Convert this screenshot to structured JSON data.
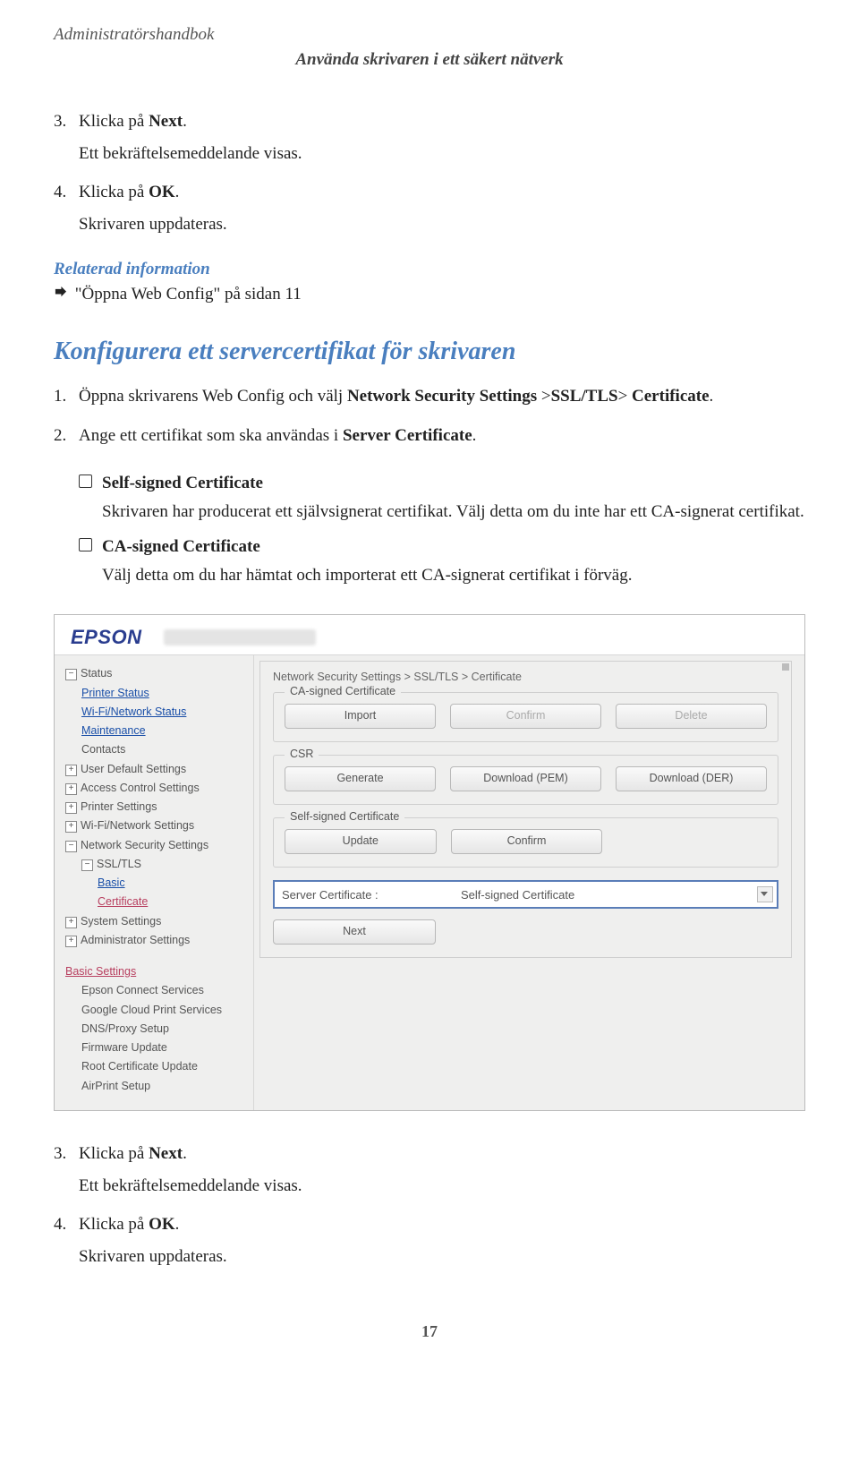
{
  "header": {
    "doc_title": "Administratörshandbok",
    "section_title": "Använda skrivaren i ett säkert nätverk"
  },
  "steps_top": [
    {
      "n": "3.",
      "text": "Klicka på ",
      "bold": "Next",
      "tail": ".",
      "sub": "Ett bekräftelsemeddelande visas."
    },
    {
      "n": "4.",
      "text": "Klicka på ",
      "bold": "OK",
      "tail": ".",
      "sub": "Skrivaren uppdateras."
    }
  ],
  "related": {
    "heading": "Relaterad information",
    "link": "\"Öppna Web Config\" på sidan 11"
  },
  "h2": "Konfigurera ett servercertifikat för skrivaren",
  "steps_mid": [
    {
      "n": "1.",
      "text": "Öppna skrivarens Web Config och välj ",
      "bold": "Network Security Settings",
      "tail1": " >",
      "bold2": "SSL/TLS",
      "tail2": "> ",
      "bold3": "Certificate",
      "tail3": "."
    },
    {
      "n": "2.",
      "text": "Ange ett certifikat som ska användas i ",
      "bold": "Server Certificate",
      "tail": "."
    }
  ],
  "bullets": [
    {
      "title": "Self-signed Certificate",
      "desc": "Skrivaren har producerat ett självsignerat certifikat. Välj detta om du inte har ett CA-signerat certifikat."
    },
    {
      "title": "CA-signed Certificate",
      "desc": "Välj detta om du har hämtat och importerat ett CA-signerat certifikat i förväg."
    }
  ],
  "mock": {
    "logo": "EPSON",
    "crumb": "Network Security Settings > SSL/TLS > Certificate",
    "side": {
      "status": "Status",
      "printer_status": "Printer Status",
      "wifi_status": "Wi-Fi/Network Status",
      "maintenance": "Maintenance",
      "contacts": "Contacts",
      "user_default": "User Default Settings",
      "access_control": "Access Control Settings",
      "printer_settings": "Printer Settings",
      "wifi_settings": "Wi-Fi/Network Settings",
      "net_sec": "Network Security Settings",
      "ssltls": "SSL/TLS",
      "basic": "Basic",
      "certificate": "Certificate",
      "system": "System Settings",
      "admin": "Administrator Settings",
      "basic_settings": "Basic Settings",
      "epson_connect": "Epson Connect Services",
      "gcp": "Google Cloud Print Services",
      "dns": "DNS/Proxy Setup",
      "fw": "Firmware Update",
      "rootcert": "Root Certificate Update",
      "airprint": "AirPrint Setup"
    },
    "groups": {
      "ca": {
        "legend": "CA-signed Certificate",
        "import": "Import",
        "confirm": "Confirm",
        "delete": "Delete"
      },
      "csr": {
        "legend": "CSR",
        "generate": "Generate",
        "dl_pem": "Download (PEM)",
        "dl_der": "Download (DER)"
      },
      "self": {
        "legend": "Self-signed Certificate",
        "update": "Update",
        "confirm": "Confirm"
      }
    },
    "select": {
      "label": "Server Certificate :",
      "value": "Self-signed Certificate"
    },
    "next": "Next"
  },
  "steps_bottom": [
    {
      "n": "3.",
      "text": "Klicka på ",
      "bold": "Next",
      "tail": ".",
      "sub": "Ett bekräftelsemeddelande visas."
    },
    {
      "n": "4.",
      "text": "Klicka på ",
      "bold": "OK",
      "tail": ".",
      "sub": "Skrivaren uppdateras."
    }
  ],
  "page_number": "17"
}
